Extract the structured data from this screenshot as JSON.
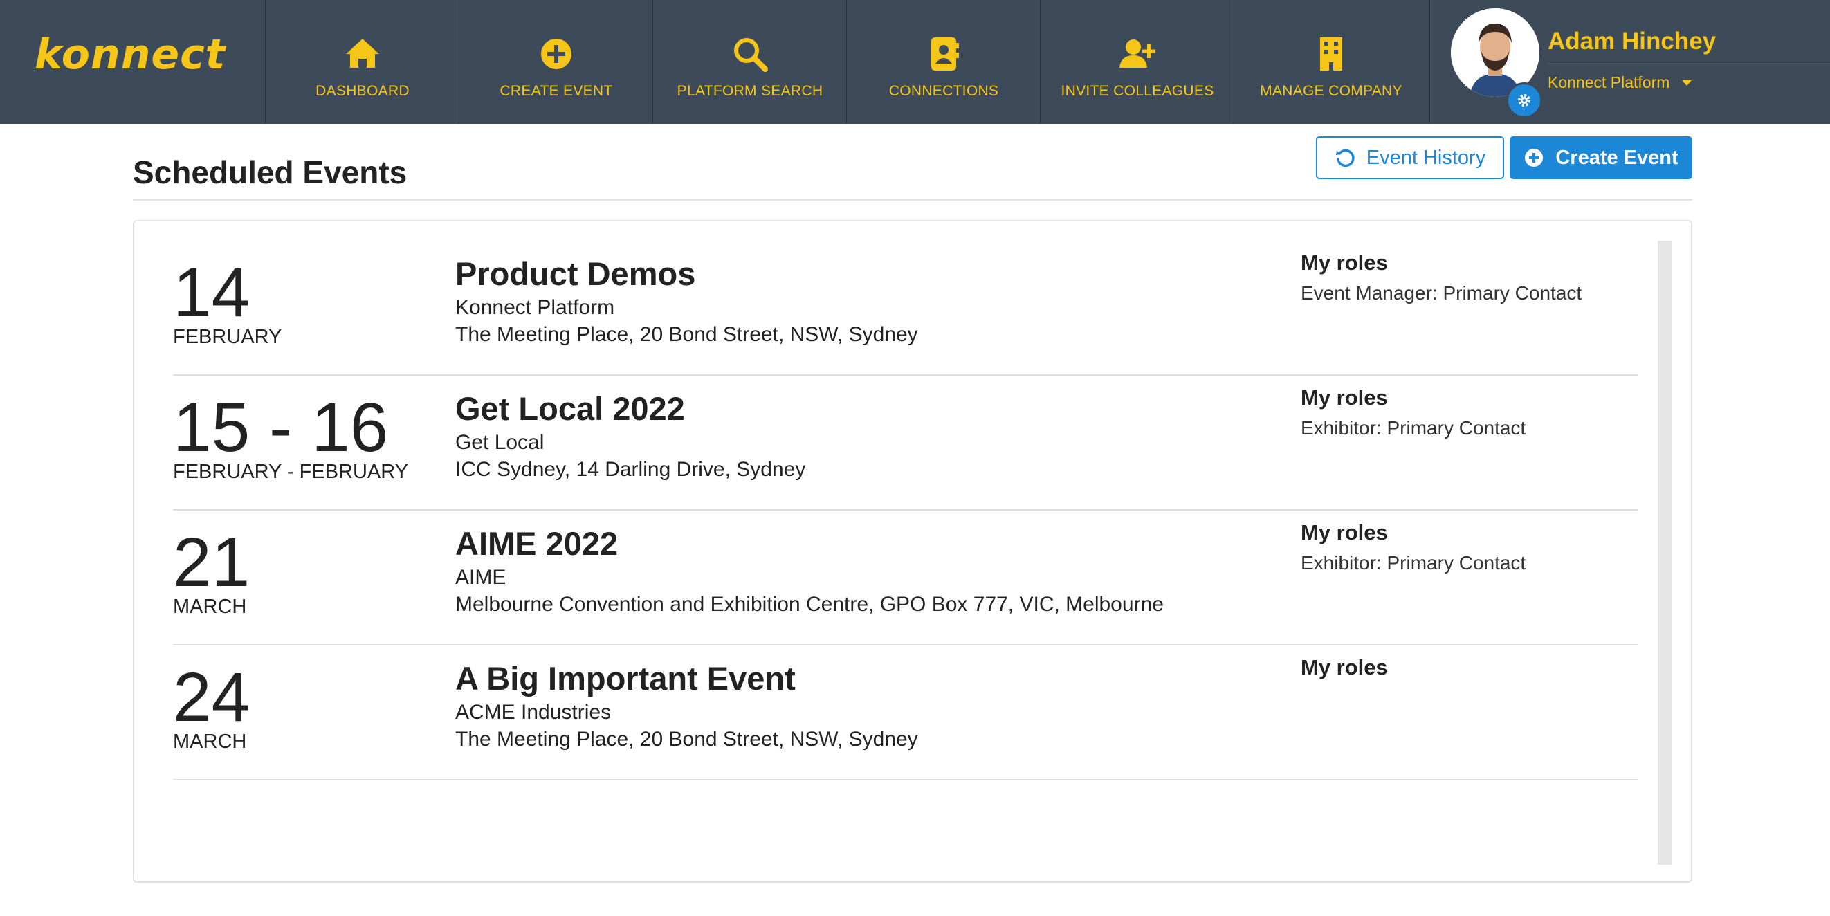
{
  "brand": {
    "logo_text": "konnect"
  },
  "nav": [
    {
      "label": "DASHBOARD",
      "icon": "home-icon"
    },
    {
      "label": "CREATE EVENT",
      "icon": "plus-circle-icon"
    },
    {
      "label": "PLATFORM SEARCH",
      "icon": "search-icon"
    },
    {
      "label": "CONNECTIONS",
      "icon": "address-book-icon"
    },
    {
      "label": "INVITE COLLEAGUES",
      "icon": "user-plus-icon"
    },
    {
      "label": "MANAGE COMPANY",
      "icon": "building-icon"
    }
  ],
  "user": {
    "name": "Adam Hinchey",
    "company": "Konnect Platform"
  },
  "page": {
    "title": "Scheduled Events",
    "event_history_label": "Event History",
    "create_event_label": "Create Event"
  },
  "events": [
    {
      "date": "14",
      "month": "FEBRUARY",
      "name": "Product Demos",
      "organiser": "Konnect Platform",
      "address": "The Meeting Place, 20 Bond Street, NSW, Sydney",
      "roles_title": "My roles",
      "roles": "Event Manager: Primary Contact"
    },
    {
      "date": "15 - 16",
      "month": "FEBRUARY - FEBRUARY",
      "name": "Get Local 2022",
      "organiser": "Get Local",
      "address": "ICC Sydney, 14 Darling Drive, Sydney",
      "roles_title": "My roles",
      "roles": "Exhibitor: Primary Contact"
    },
    {
      "date": "21",
      "month": "MARCH",
      "name": "AIME 2022",
      "organiser": "AIME",
      "address": "Melbourne Convention and Exhibition Centre, GPO Box 777, VIC, Melbourne",
      "roles_title": "My roles",
      "roles": "Exhibitor: Primary Contact"
    },
    {
      "date": "24",
      "month": "MARCH",
      "name": "A Big Important Event",
      "organiser": "ACME Industries",
      "address": "The Meeting Place, 20 Bond Street, NSW, Sydney",
      "roles_title": "My roles",
      "roles": ""
    }
  ],
  "colors": {
    "header_bg": "#3d4a5a",
    "accent_yellow": "#f5c518",
    "primary_blue": "#1e88d8"
  }
}
